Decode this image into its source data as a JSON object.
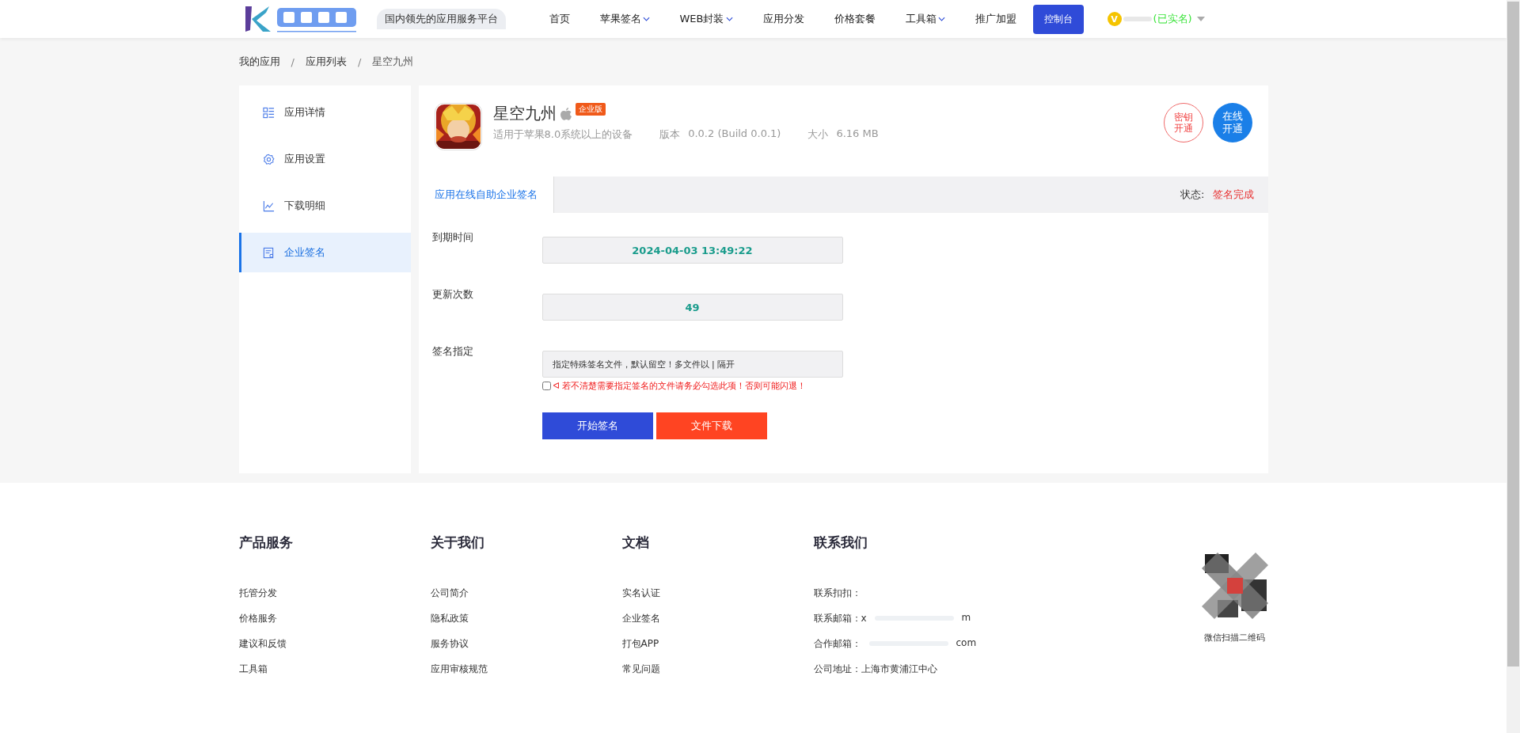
{
  "header": {
    "tagline": "国内领先的应用服务平台",
    "nav": [
      {
        "label": "首页",
        "dropdown": false
      },
      {
        "label": "苹果签名",
        "dropdown": true
      },
      {
        "label": "WEB封装",
        "dropdown": true
      },
      {
        "label": "应用分发",
        "dropdown": false
      },
      {
        "label": "价格套餐",
        "dropdown": false
      },
      {
        "label": "工具箱",
        "dropdown": true
      },
      {
        "label": "推广加盟",
        "dropdown": false
      }
    ],
    "console_button": "控制台",
    "user": {
      "badge": "V",
      "verified": "(已实名)"
    }
  },
  "breadcrumb": {
    "items": [
      "我的应用",
      "应用列表",
      "星空九州"
    ],
    "separator": "/"
  },
  "sidebar": {
    "items": [
      {
        "label": "应用详情",
        "selected": false
      },
      {
        "label": "应用设置",
        "selected": false
      },
      {
        "label": "下载明细",
        "selected": false
      },
      {
        "label": "企业签名",
        "selected": true
      }
    ]
  },
  "app": {
    "name": "星空九州",
    "badge": "企业版",
    "requirement": "适用于苹果8.0系统以上的设备",
    "version_label": "版本",
    "version": "0.0.2 (Build 0.0.1)",
    "size_label": "大小",
    "size": "6.16 MB",
    "actions": [
      {
        "label": "密钥开通",
        "kind": "outline"
      },
      {
        "label": "在线开通",
        "kind": "filled"
      }
    ]
  },
  "tab": {
    "label": "应用在线自助企业签名",
    "status_label": "状态:",
    "status": "签名完成"
  },
  "form": {
    "fields": [
      {
        "label": "到期时间",
        "value": "2024-04-03 13:49:22",
        "kind": "readonly"
      },
      {
        "label": "更新次数",
        "value": "49",
        "kind": "readonly"
      },
      {
        "label": "签名指定",
        "placeholder": "指定特殊签名文件，默认留空！多文件以 | 隔开",
        "kind": "input"
      }
    ],
    "checkbox": {
      "checked": false,
      "label": "ᐊ 若不清楚需要指定签名的文件请务必勾选此项！否则可能闪退！"
    },
    "buttons": [
      {
        "label": "开始签名",
        "kind": "primary"
      },
      {
        "label": "文件下载",
        "kind": "danger"
      }
    ]
  },
  "footer": {
    "columns": [
      {
        "title": "产品服务",
        "links": [
          "托管分发",
          "价格服务",
          "建议和反馈",
          "工具箱"
        ]
      },
      {
        "title": "关于我们",
        "links": [
          "公司简介",
          "隐私政策",
          "服务协议",
          "应用审核规范"
        ]
      },
      {
        "title": "文档",
        "links": [
          "实名认证",
          "企业签名",
          "打包APP",
          "常见问题"
        ]
      },
      {
        "title": "联系我们",
        "contacts": [
          {
            "label": "联系扣扣："
          },
          {
            "label": "联系邮箱：x",
            "tail": "m"
          },
          {
            "label": "合作邮箱：",
            "tail": "com"
          },
          {
            "label": "公司地址：上海市黄浦江中心"
          }
        ]
      }
    ],
    "qr_caption": "微信扫描二维码"
  }
}
